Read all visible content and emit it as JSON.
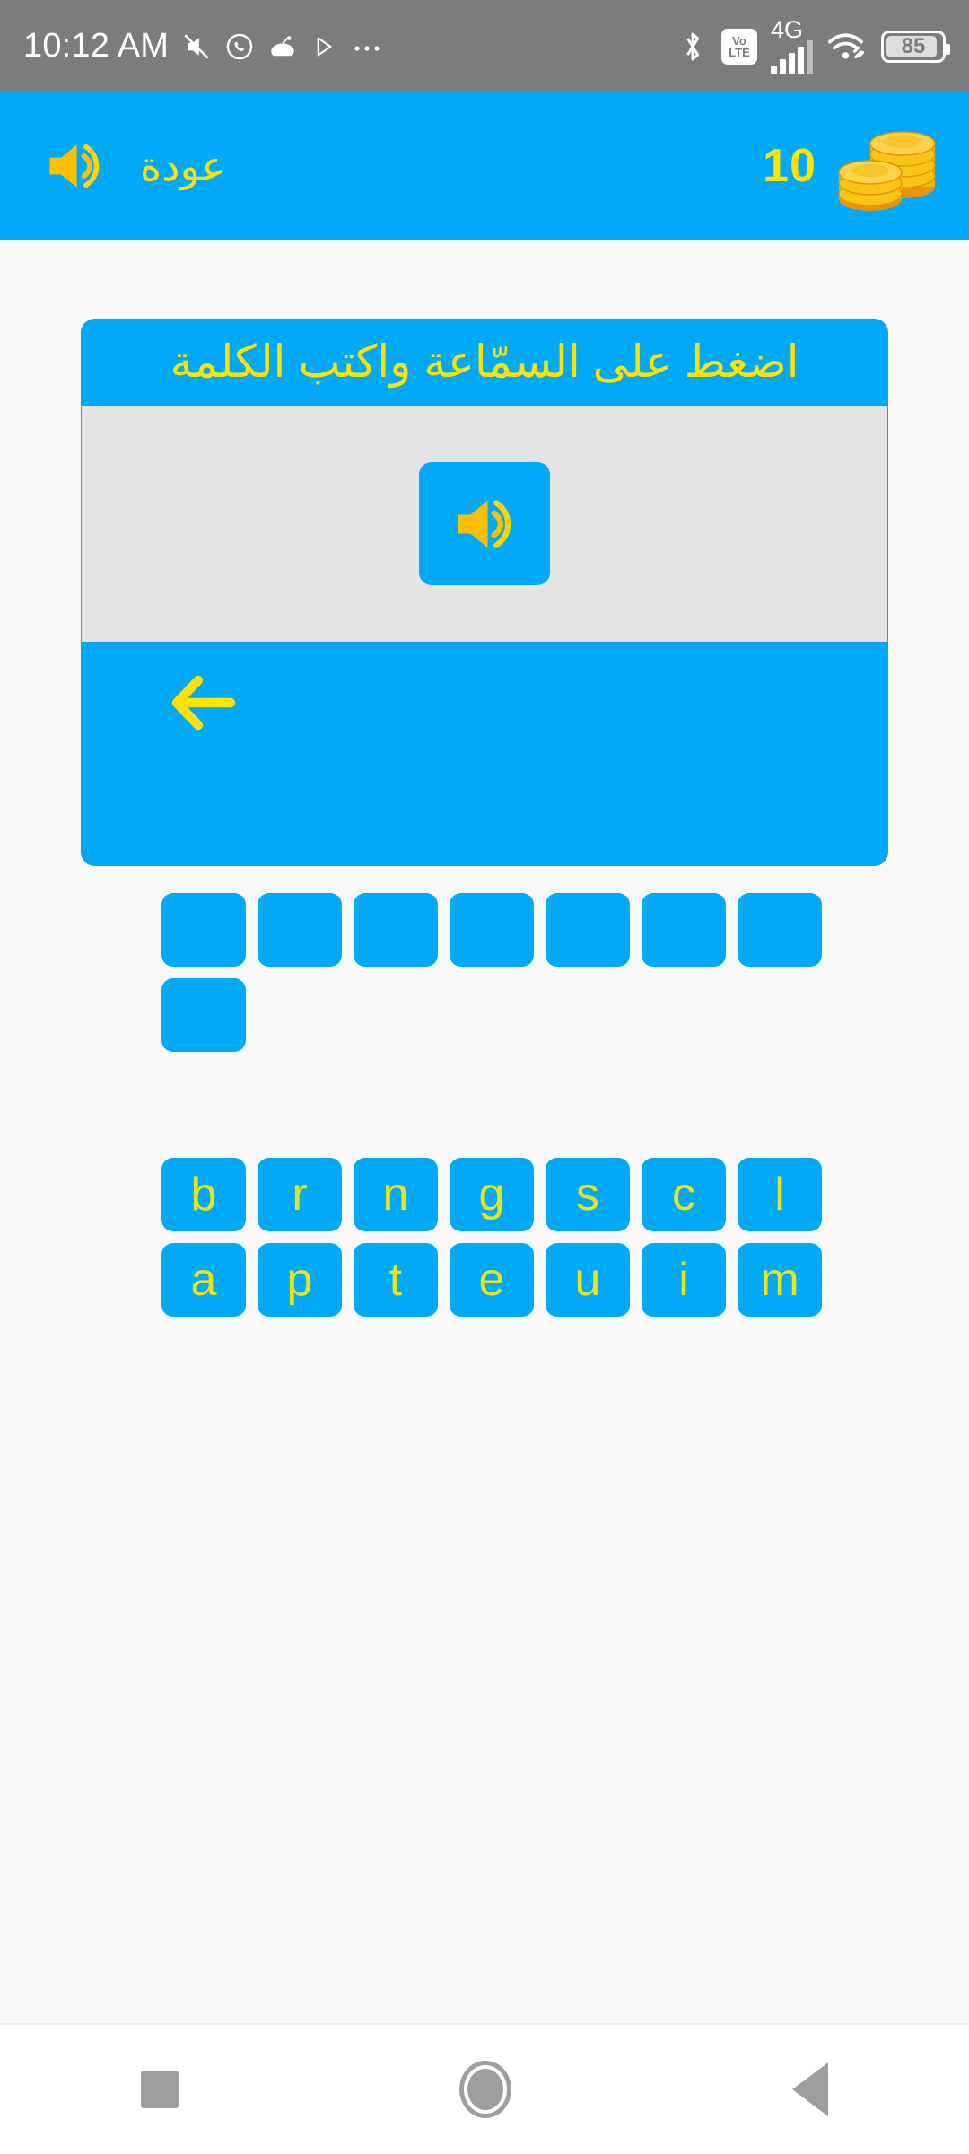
{
  "status_bar": {
    "time": "10:12 AM",
    "battery_percent": "85",
    "network_generation": "4G",
    "volte_top": "Vo",
    "volte_bottom": "LTE",
    "notification_icons": [
      "mute-icon",
      "whatsapp-icon",
      "reddit-icon",
      "play-icon",
      "more-dots-icon"
    ],
    "right_icons": [
      "bluetooth-icon",
      "volte-icon",
      "signal-icon",
      "wifi-link-icon",
      "battery-icon"
    ],
    "bar_color": "#7C7C7C"
  },
  "app_bar": {
    "back_label": "عودة",
    "speaker_icon": "speaker-icon",
    "coin_count": "10",
    "coin_icon": "coin-stack-icon",
    "background_color": "#02A9F7",
    "text_color": "#FFE200"
  },
  "card": {
    "instruction": "اضغط على السمّاعة واكتب الكلمة",
    "play_sound_icon": "speaker-icon",
    "backspace_icon": "left-arrow-icon",
    "header_color": "#02A9F7",
    "body_color": "#E4E4E4",
    "footer_color": "#02A9F7"
  },
  "answer": {
    "slot_count": 8,
    "slots": [
      "",
      "",
      "",
      "",
      "",
      "",
      "",
      ""
    ],
    "tile_color": "#02A9F7"
  },
  "keyboard": {
    "row1": [
      "b",
      "r",
      "n",
      "g",
      "s",
      "c",
      "l"
    ],
    "row2": [
      "a",
      "p",
      "t",
      "e",
      "u",
      "i",
      "m"
    ],
    "key_color": "#02A9F7",
    "letter_color": "#EDE319"
  },
  "nav_bar": {
    "recents": "square-recents-icon",
    "home": "circle-home-icon",
    "back": "triangle-back-icon"
  },
  "theme": {
    "page_background": "#F8F8F8",
    "primary_blue": "#02A9F7",
    "accent_yellow": "#FFE200",
    "speaker_amber": "#FBBF05"
  }
}
